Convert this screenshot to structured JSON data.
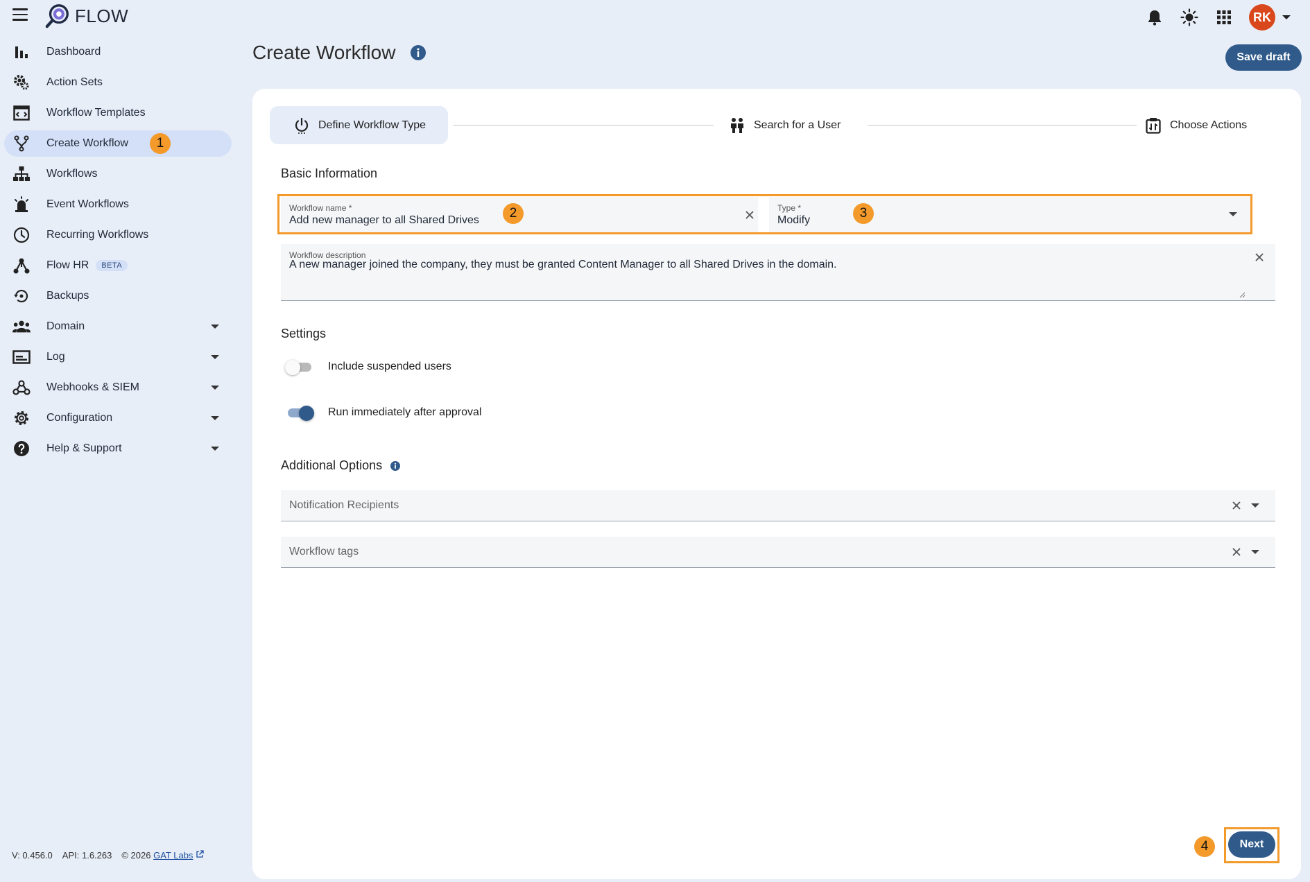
{
  "app": {
    "name": "FLOW",
    "avatar_initials": "RK",
    "avatar_color": "#d9481c",
    "accent": "#2f5a8a",
    "highlight_color": "#f39a2b"
  },
  "sidebar": {
    "items": [
      {
        "label": "Dashboard",
        "icon": "bar-chart-icon"
      },
      {
        "label": "Action Sets",
        "icon": "gears-icon"
      },
      {
        "label": "Workflow Templates",
        "icon": "template-icon"
      },
      {
        "label": "Create Workflow",
        "icon": "fork-icon",
        "active": true,
        "badge": "1"
      },
      {
        "label": "Workflows",
        "icon": "hierarchy-icon"
      },
      {
        "label": "Event Workflows",
        "icon": "alarm-icon"
      },
      {
        "label": "Recurring Workflows",
        "icon": "clock-icon"
      },
      {
        "label": "Flow HR",
        "icon": "network-icon",
        "tag": "BETA"
      },
      {
        "label": "Backups",
        "icon": "backup-icon"
      },
      {
        "label": "Domain",
        "icon": "people-icon",
        "expandable": true
      },
      {
        "label": "Log",
        "icon": "log-icon",
        "expandable": true
      },
      {
        "label": "Webhooks & SIEM",
        "icon": "webhook-icon",
        "expandable": true
      },
      {
        "label": "Configuration",
        "icon": "gear-icon",
        "expandable": true
      },
      {
        "label": "Help & Support",
        "icon": "help-icon",
        "expandable": true
      }
    ]
  },
  "footer": {
    "version": "V: 0.456.0",
    "api": "API: 1.6.263",
    "copyright": "© 2026",
    "company_link": "GAT Labs"
  },
  "header": {
    "title": "Create Workflow",
    "save_draft_label": "Save draft"
  },
  "stepper": {
    "steps": [
      {
        "label": "Define Workflow Type",
        "icon": "power-icon",
        "active": true
      },
      {
        "label": "Search for a User",
        "icon": "users-icon"
      },
      {
        "label": "Choose Actions",
        "icon": "actions-icon"
      }
    ]
  },
  "basic_info": {
    "title": "Basic Information",
    "workflow_name": {
      "label": "Workflow name *",
      "value": "Add new manager to all Shared Drives",
      "badge": "2"
    },
    "type": {
      "label": "Type *",
      "value": "Modify",
      "badge": "3"
    },
    "description": {
      "label": "Workflow description",
      "value": "A new manager joined the company, they must be granted Content Manager to all Shared Drives in the domain."
    }
  },
  "settings": {
    "title": "Settings",
    "include_suspended": {
      "label": "Include suspended users",
      "enabled": false
    },
    "run_immediately": {
      "label": "Run immediately after approval",
      "enabled": true
    }
  },
  "additional": {
    "title": "Additional Options",
    "notification_placeholder": "Notification Recipients",
    "tags_placeholder": "Workflow tags"
  },
  "next": {
    "label": "Next",
    "badge": "4"
  }
}
